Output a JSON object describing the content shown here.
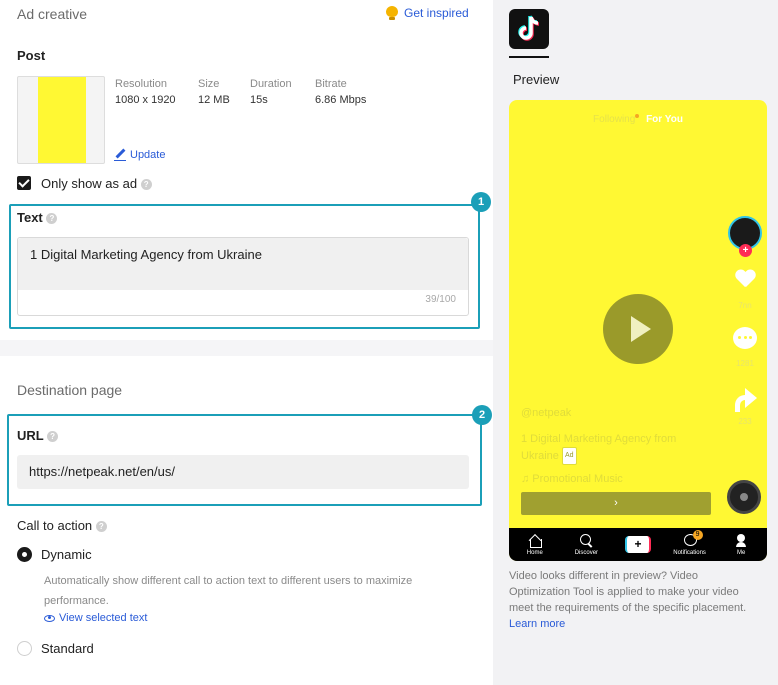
{
  "ad_creative": {
    "section_title": "Ad creative",
    "get_inspired": "Get inspired",
    "post_label": "Post",
    "meta": [
      {
        "key": "Resolution",
        "value": "1080 x 1920"
      },
      {
        "key": "Size",
        "value": "12 MB"
      },
      {
        "key": "Duration",
        "value": "15s"
      },
      {
        "key": "Bitrate",
        "value": "6.86 Mbps"
      }
    ],
    "update": "Update",
    "only_show_as_ad": "Only show as ad",
    "text_label": "Text",
    "text_value": "1 Digital Marketing Agency from Ukraine",
    "text_counter": "39/100",
    "badge_1": "1"
  },
  "destination": {
    "section_title": "Destination page",
    "url_label": "URL",
    "url_value": "https://netpeak.net/en/us/",
    "badge_2": "2",
    "cta_label": "Call to action",
    "dynamic_label": "Dynamic",
    "dynamic_desc": "Automatically show different call to action text to different users to maximize performance.",
    "view_selected_text": "View selected text",
    "standard_label": "Standard"
  },
  "preview": {
    "title": "Preview",
    "tab_following": "Following",
    "tab_for_you": "For You",
    "likes": "7nn",
    "comments": "1281",
    "shares": "233",
    "handle": "@netpeak",
    "caption": "1 Digital Marketing Agency from Ukraine",
    "ad_tag": "Ad",
    "music": "♫ Promotional Music",
    "cta_arrow": "›",
    "nav": {
      "home": "Home",
      "discover": "Discover",
      "create": "+",
      "notifications": "Notifications",
      "notif_count": "9",
      "me": "Me"
    },
    "note": "Video looks different in preview? Video Optimization Tool is applied to make your video meet the requirements of the specific placement.",
    "learn_more": "Learn more"
  },
  "colors": {
    "accent_link": "#2a5bd7",
    "highlight": "#1b9fb8",
    "preview_bg": "#fff833"
  }
}
